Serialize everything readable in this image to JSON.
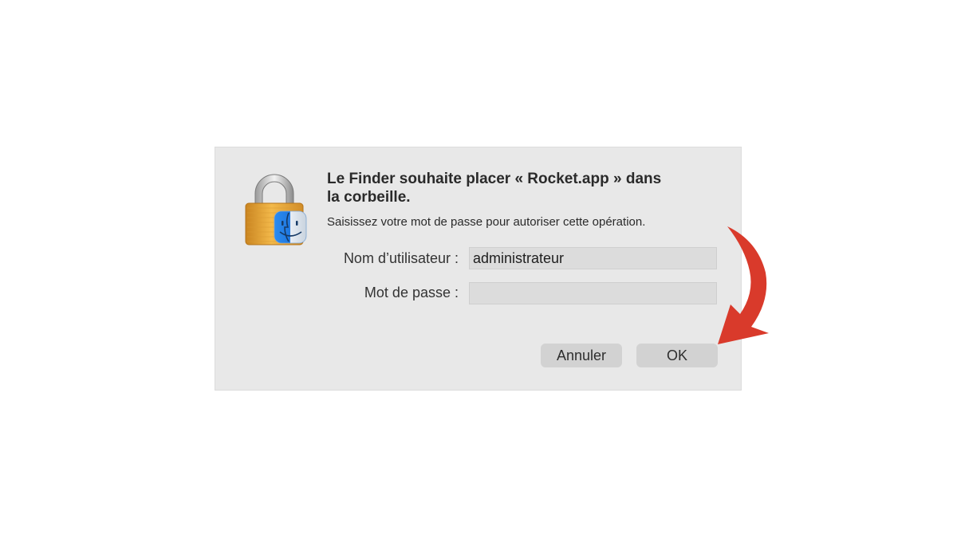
{
  "dialog": {
    "title_line1": "Le Finder souhaite placer « Rocket.app » dans",
    "title_line2": "la corbeille.",
    "subtitle": "Saisissez votre mot de passe pour autoriser cette opération.",
    "icon": "lock-with-finder-icon",
    "username_label": "Nom d’utilisateur :",
    "username_value": "administrateur",
    "password_label": "Mot de passe :",
    "password_value": "",
    "cancel_label": "Annuler",
    "ok_label": "OK"
  },
  "annotation": {
    "icon": "red-curved-arrow",
    "color": "#d93a2b"
  },
  "colors": {
    "dialog_background": "#e8e8e8",
    "button_background": "#d2d2d2",
    "input_background": "#dcdcdc",
    "lock_gold": "#e6a43a",
    "finder_blue": "#2f8ff0"
  }
}
